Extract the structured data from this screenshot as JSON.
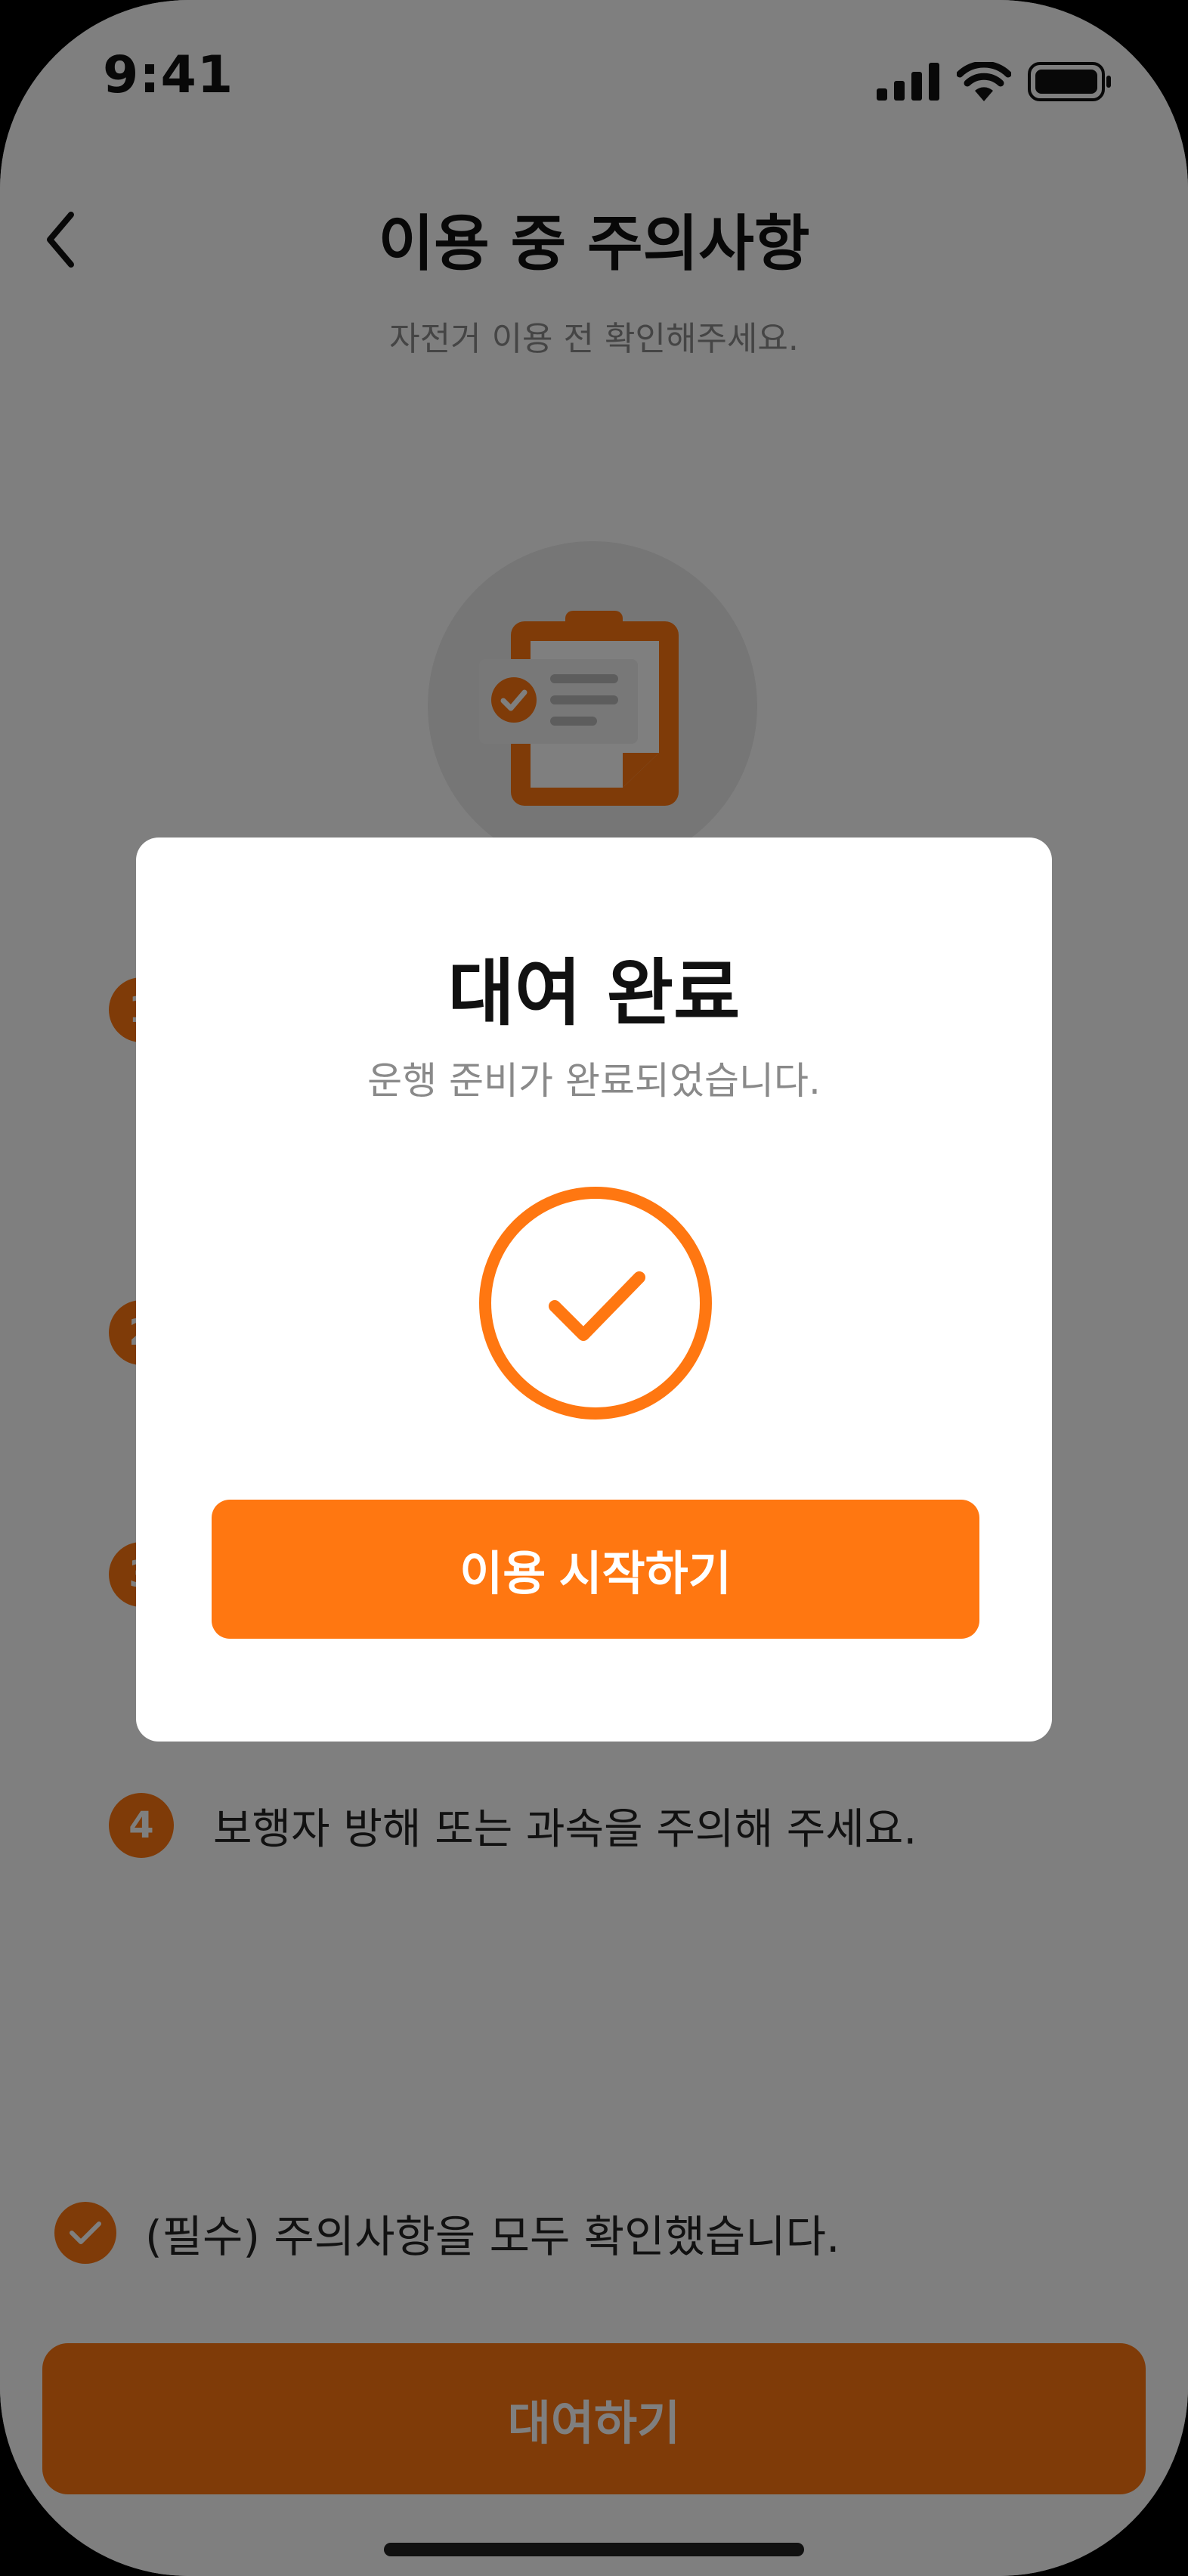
{
  "status_bar": {
    "time": "9:41"
  },
  "header": {
    "title": "이용 중 주의사항",
    "subtitle": "자전거 이용 전 확인해주세요."
  },
  "illustration": {
    "icon": "clipboard-check-icon"
  },
  "notices": [
    {
      "number": "1",
      "text": ""
    },
    {
      "number": "2",
      "text": ""
    },
    {
      "number": "3",
      "text": ""
    },
    {
      "number": "4",
      "text": "보행자 방해 또는 과속을 주의해 주세요."
    }
  ],
  "required_check": {
    "label": "(필수) 주의사항을 모두 확인했습니다.",
    "checked": true
  },
  "bottom_button": {
    "label": "대여하기"
  },
  "modal": {
    "title": "대여 완료",
    "subtitle": "운행 준비가 완료되었습니다.",
    "icon": "check-circle-icon",
    "primary_button": "이용 시작하기"
  },
  "colors": {
    "accent": "#FF7711",
    "overlay": "rgba(0,0,0,0.5)"
  }
}
